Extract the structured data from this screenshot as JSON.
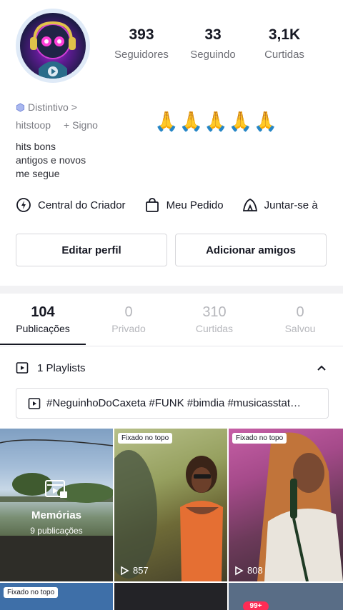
{
  "profile": {
    "stats": [
      {
        "value": "393",
        "label": "Seguidores"
      },
      {
        "value": "33",
        "label": "Seguindo"
      },
      {
        "value": "3,1K",
        "label": "Curtidas"
      }
    ],
    "badge": "Distintivo",
    "badge_chevron": ">",
    "username": "hitstoop",
    "sign_link": "+ Signo",
    "emojis": "🙏🙏🙏🙏🙏",
    "bio_lines": [
      "hits bons",
      "antigos e novos",
      "me segue"
    ]
  },
  "quick_links": [
    {
      "label": "Central do Criador",
      "icon": "lightbulb-icon"
    },
    {
      "label": "Meu Pedido",
      "icon": "shopping-bag-icon"
    },
    {
      "label": "Juntar-se à",
      "icon": "tent-icon"
    }
  ],
  "buttons": {
    "edit": "Editar perfil",
    "add_friends": "Adicionar amigos"
  },
  "tabs": [
    {
      "count": "104",
      "label": "Publicações",
      "active": true
    },
    {
      "count": "0",
      "label": "Privado",
      "active": false
    },
    {
      "count": "310",
      "label": "Curtidas",
      "active": false
    },
    {
      "count": "0",
      "label": "Salvou",
      "active": false
    }
  ],
  "playlists": {
    "header": "1 Playlists",
    "item": "#NeguinhoDoCaxeta #FUNK #bimdia #musicasstat…"
  },
  "grid": {
    "memorias": {
      "title": "Memórias",
      "subtitle": "9 publicações"
    },
    "video1": {
      "pin": "Fixado no topo",
      "views": "857"
    },
    "video2": {
      "pin": "Fixado no topo",
      "views": "808"
    },
    "row2_pin": "Fixado no topo"
  },
  "nav": {
    "badge": "99+"
  },
  "colors": {
    "accent": "#fe2c55",
    "text": "#161823",
    "muted": "#6e6f76"
  }
}
